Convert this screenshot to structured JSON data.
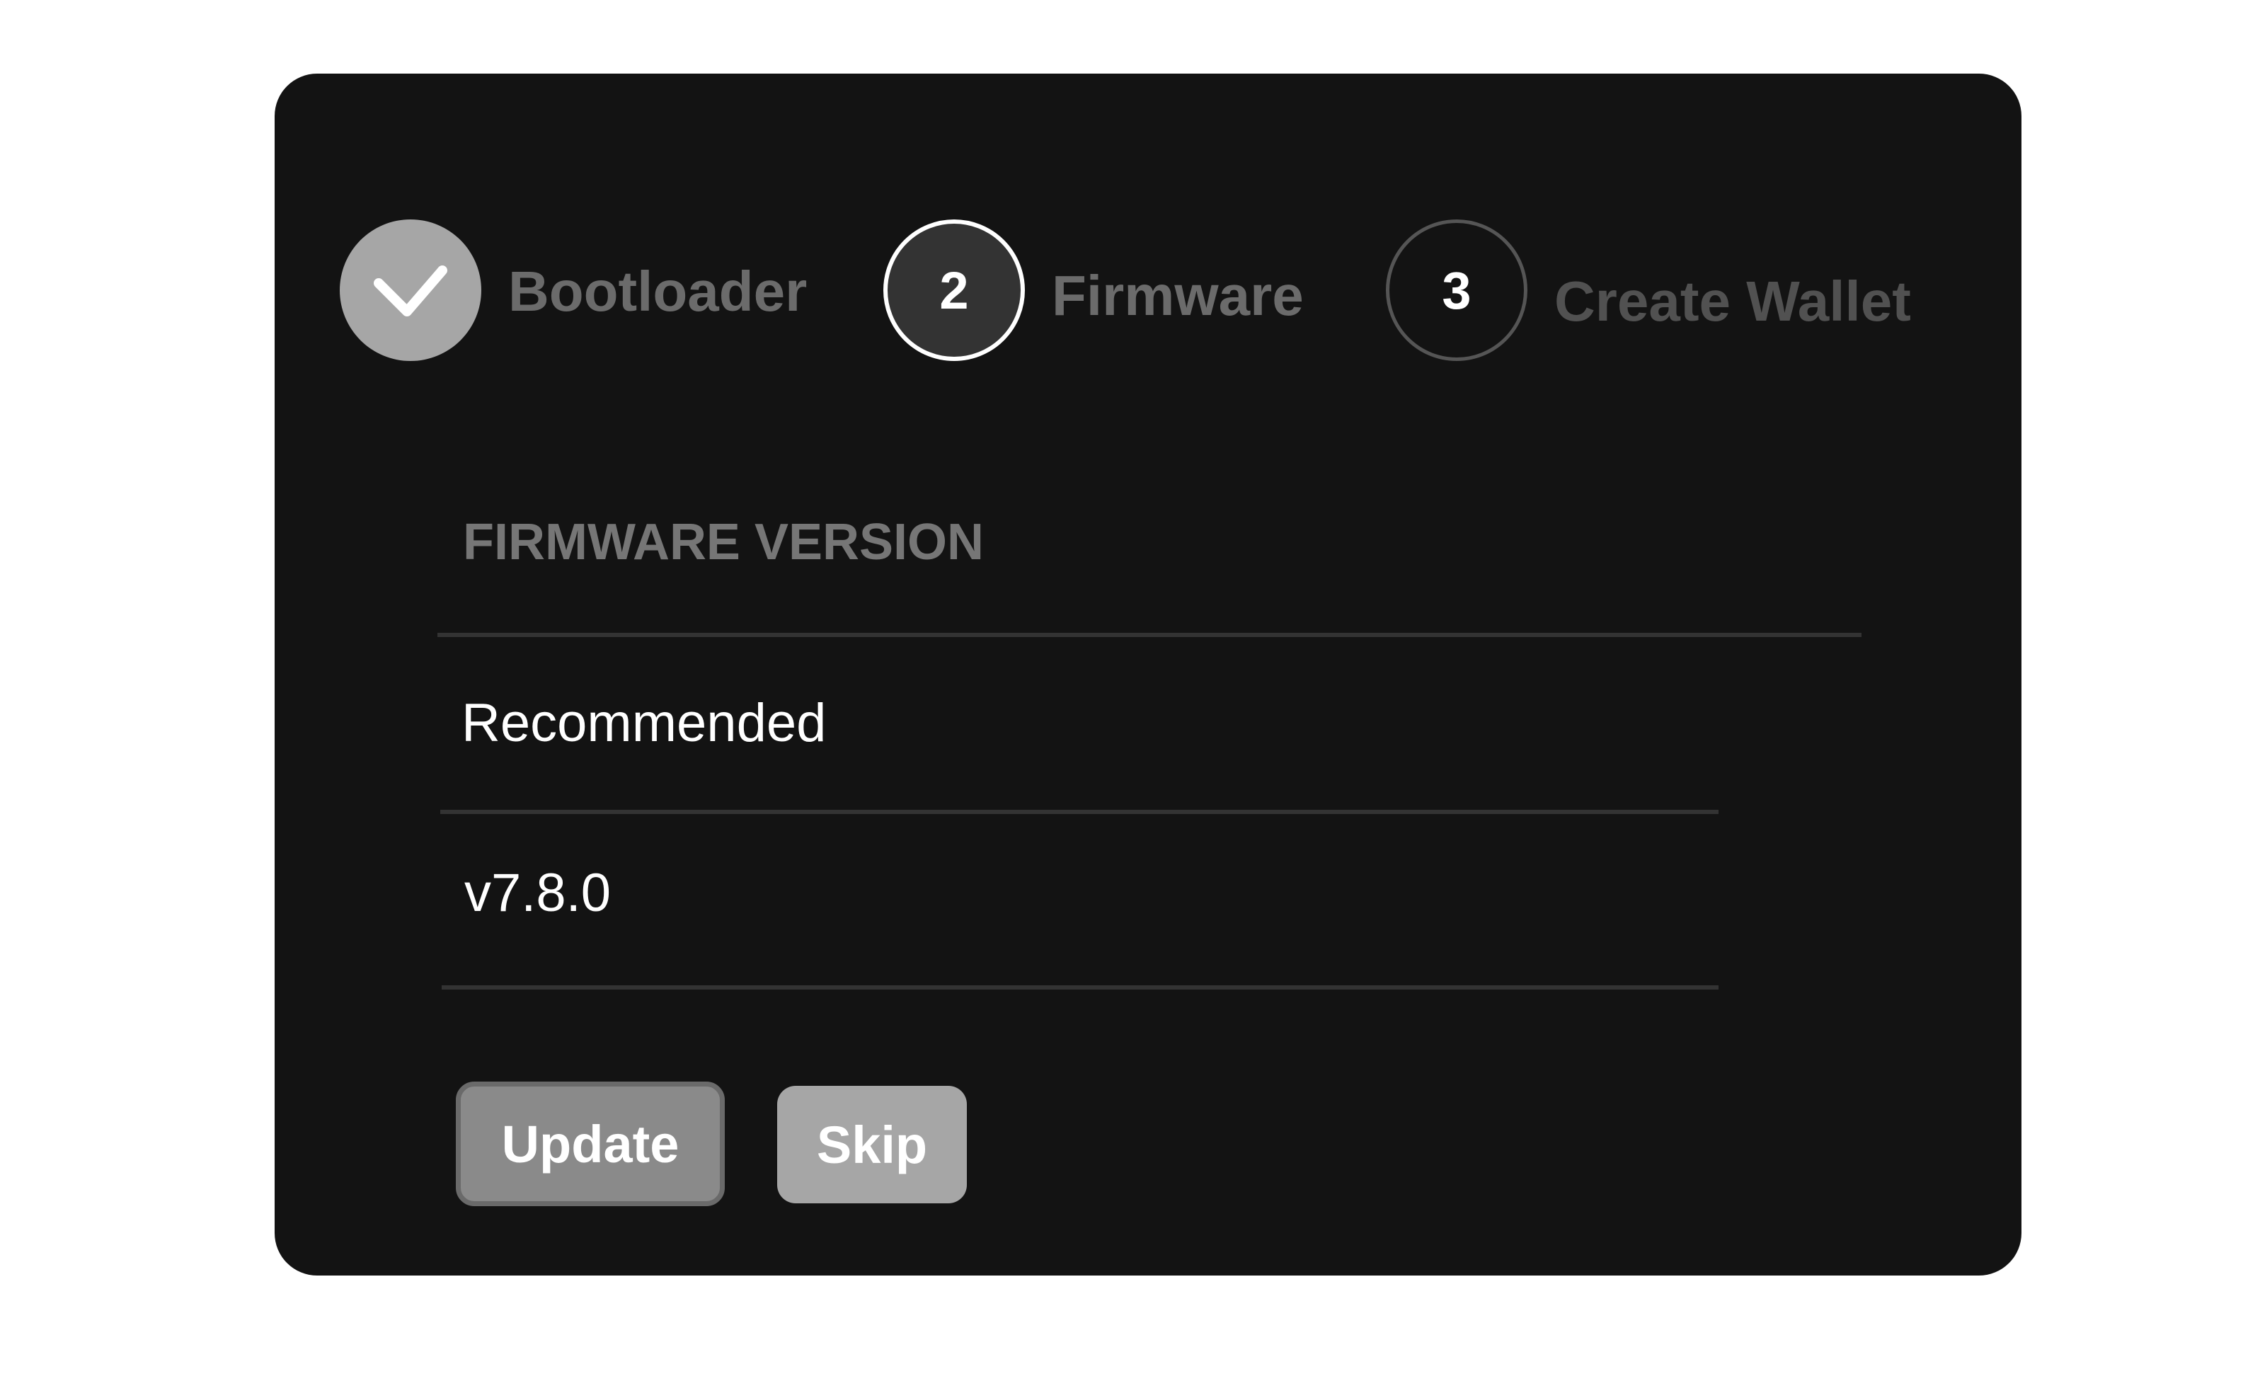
{
  "stepper": {
    "steps": [
      {
        "number": "",
        "label": "Bootloader",
        "state": "completed",
        "icon": "check-icon"
      },
      {
        "number": "2",
        "label": "Firmware",
        "state": "current"
      },
      {
        "number": "3",
        "label": "Create Wallet",
        "state": "upcoming"
      }
    ]
  },
  "firmware": {
    "section_title": "FIRMWARE VERSION",
    "rows": [
      {
        "text": "Recommended"
      },
      {
        "text": "v7.8.0"
      }
    ]
  },
  "actions": {
    "update_label": "Update",
    "skip_label": "Skip"
  },
  "colors": {
    "card_background": "#131313",
    "page_background": "#ffffff",
    "completed_step": "#a6a6a6",
    "current_step": "#333333"
  }
}
